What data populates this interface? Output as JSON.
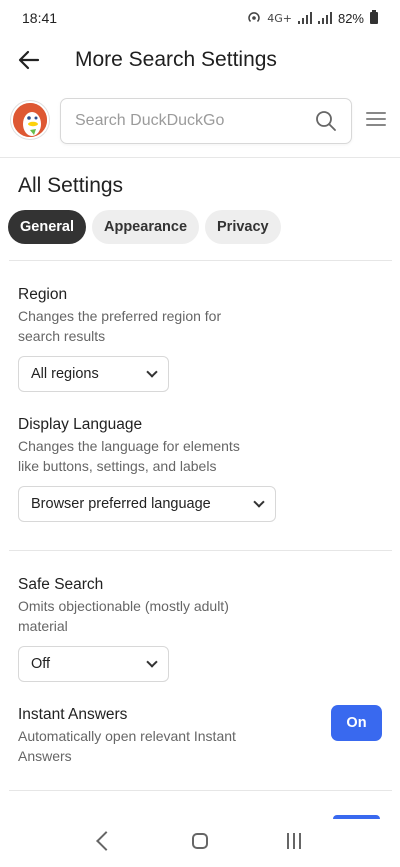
{
  "status": {
    "time": "18:41",
    "network": "4G+",
    "battery": "82%"
  },
  "appbar": {
    "title": "More Search Settings"
  },
  "search": {
    "placeholder": "Search DuckDuckGo"
  },
  "page": {
    "title": "All Settings"
  },
  "tabs": [
    {
      "label": "General",
      "active": true
    },
    {
      "label": "Appearance",
      "active": false
    },
    {
      "label": "Privacy",
      "active": false
    }
  ],
  "settings": {
    "region": {
      "title": "Region",
      "desc": "Changes the preferred region for search results",
      "value": "All regions"
    },
    "language": {
      "title": "Display Language",
      "desc": "Changes the language for elements like buttons, settings, and labels",
      "value": "Browser preferred language"
    },
    "safe_search": {
      "title": "Safe Search",
      "desc": "Omits objectionable (mostly adult) material",
      "value": "Off"
    },
    "instant_answers": {
      "title": "Instant Answers",
      "desc": "Automatically open relevant Instant Answers",
      "toggle": "On"
    }
  },
  "colors": {
    "accent": "#3969ef",
    "active_tab": "#333333",
    "logo": "#de5833"
  }
}
